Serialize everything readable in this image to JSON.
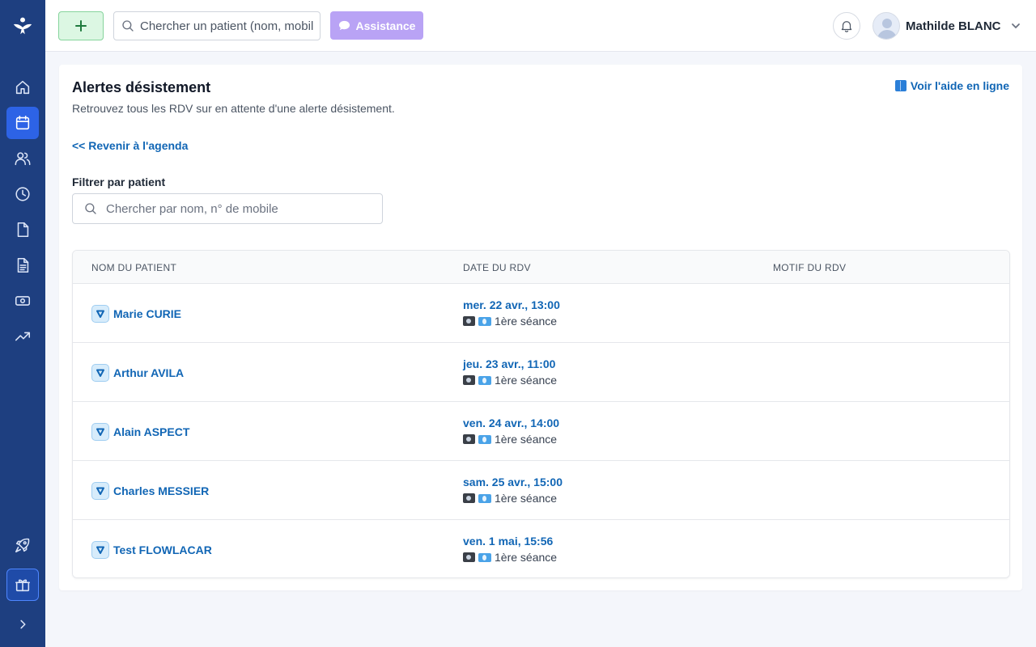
{
  "topbar": {
    "search_placeholder": "Chercher un patient (nom, mobile, …)",
    "assist_label": "Assistance",
    "user_name": "Mathilde BLANC"
  },
  "sidebar": {
    "items": [
      "home",
      "agenda",
      "patients",
      "historique",
      "documents",
      "factures",
      "paiements",
      "statistiques",
      "nouveautes",
      "cadeau",
      "deplier"
    ]
  },
  "page": {
    "title": "Alertes désistement",
    "subtitle": "Retrouvez tous les RDV sur en attente d'une alerte désistement.",
    "help_link": "Voir l'aide en ligne",
    "back_link": "<< Revenir à l'agenda",
    "filter_label": "Filtrer par patient",
    "filter_placeholder": "Chercher par nom, n° de mobile"
  },
  "table": {
    "headers": [
      "NOM DU PATIENT",
      "DATE DU RDV",
      "MOTIF DU RDV"
    ],
    "rows": [
      {
        "name": "Marie CURIE",
        "date": "mer. 22 avr., 13:00",
        "type": "1ère séance",
        "motif": ""
      },
      {
        "name": "Arthur AVILA",
        "date": "jeu. 23 avr., 11:00",
        "type": "1ère séance",
        "motif": ""
      },
      {
        "name": "Alain ASPECT",
        "date": "ven. 24 avr., 14:00",
        "type": "1ère séance",
        "motif": ""
      },
      {
        "name": "Charles MESSIER",
        "date": "sam. 25 avr., 15:00",
        "type": "1ère séance",
        "motif": ""
      },
      {
        "name": "Test FLOWLACAR",
        "date": "ven. 1 mai, 15:56",
        "type": "1ère séance",
        "motif": ""
      }
    ]
  },
  "colors": {
    "sidebar": "#1e3f80",
    "active": "#2d63e6",
    "link": "#1166b5",
    "assist": "#b9a3f5",
    "add": "#dcf7e3"
  }
}
